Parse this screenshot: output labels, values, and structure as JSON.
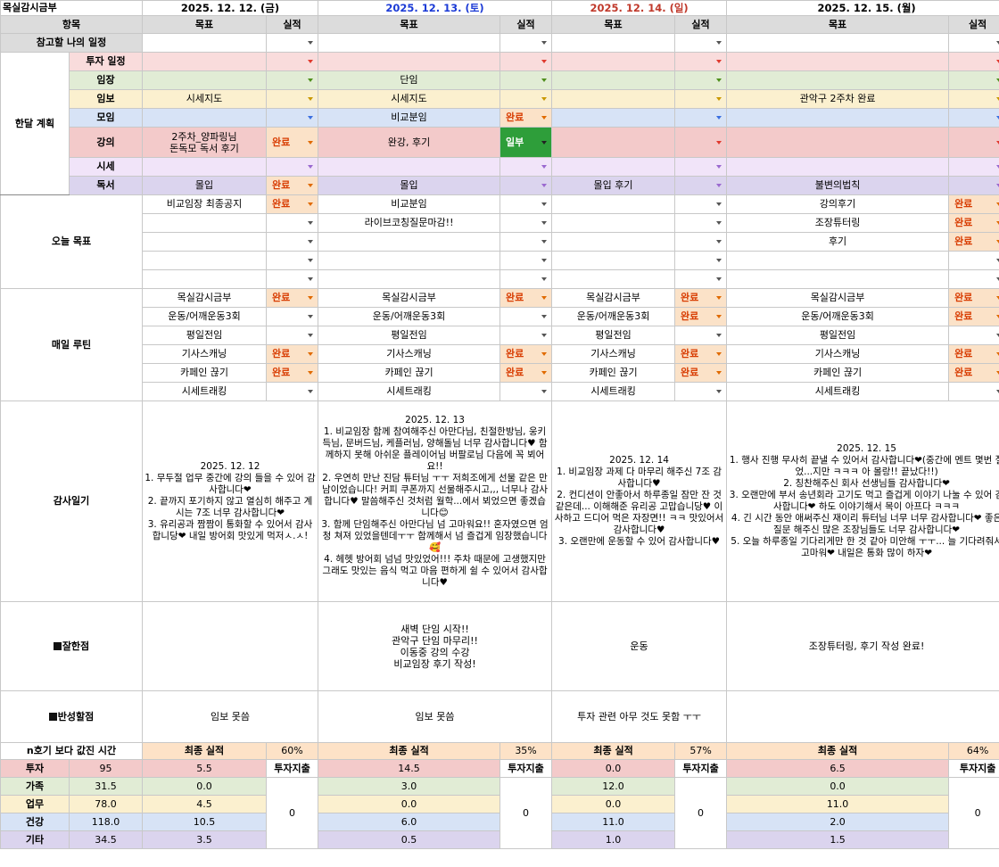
{
  "title": "목실감시금부",
  "dates": [
    "2025. 12. 12. (금)",
    "2025. 12. 13. (토)",
    "2025. 12. 14. (일)",
    "2025. 12. 15. (월)"
  ],
  "header": {
    "item": "항목",
    "goal": "목표",
    "result": "실적"
  },
  "reference_label": "참고할 나의 일정",
  "monthly_group": "한달 계획",
  "monthly_items": [
    "투자 일정",
    "임장",
    "임보",
    "모임",
    "강의",
    "시세",
    "독서"
  ],
  "monthly": {
    "d1": {
      "r2": "시세지도",
      "r4": "2주차_양파링님\n돈독모 독서 후기",
      "r4s": "완료",
      "r6": "몰입",
      "r6s": "완료"
    },
    "d2": {
      "r1": "단임",
      "r2": "시세지도",
      "r3": "비교분임",
      "r3s": "완료",
      "r4": "완강, 후기",
      "r4s": "일부",
      "r6": "몰입"
    },
    "d3": {
      "r6": "몰입 후기"
    },
    "d4": {
      "r2": "관악구 2주차 완료",
      "r6": "불변의법칙"
    }
  },
  "today_label": "오늘 목표",
  "today": {
    "d1": [
      "비교임장 최종공지",
      "",
      "",
      "",
      ""
    ],
    "d1s": [
      "완료",
      "",
      "",
      "",
      ""
    ],
    "d2": [
      "비교분임",
      "라이브코칭질문마감!!",
      "",
      "",
      ""
    ],
    "d3": [
      "",
      "",
      "",
      "",
      ""
    ],
    "d4": [
      "강의후기",
      "조장튜터링",
      "후기",
      "",
      ""
    ],
    "d4s": [
      "완료",
      "완료",
      "완료",
      "",
      ""
    ]
  },
  "routine_label": "매일 루틴",
  "routine_items": [
    "목실감시금부",
    "운동/어깨운동3회",
    "평일전임",
    "기사스캐닝",
    "카페인 끊기",
    "시세트래킹"
  ],
  "routine_status": {
    "d1": [
      "완료",
      "",
      "",
      "완료",
      "완료",
      ""
    ],
    "d2": [
      "완료",
      "",
      "",
      "완료",
      "완료",
      ""
    ],
    "d3": [
      "완료",
      "완료",
      "",
      "완료",
      "완료",
      ""
    ],
    "d4": [
      "완료",
      "완료",
      "",
      "완료",
      "완료",
      ""
    ]
  },
  "gratitude_label": "감사일기",
  "gratitude": {
    "d1": "2025. 12. 12\n1. 무두절 업무 중간에 강의 들을 수 있어 감사합니다❤\n2. 끝까지 포기하지 않고 열심히 해주고 계시는 7조 너무 감사합니다❤\n3. 유리공과 짬짬이 통화할 수 있어서 감사합니당❤ 내일 방어회 맛있게 먹저ㅅ.ㅅ!",
    "d2": "2025. 12. 13\n1. 비교임장 함께 참여해주신 아만다님, 친절한방님, 웅키득님, 문버드님, 케플러님, 양해돌님 너무 감사합니다♥ 함께하지 못해 아쉬운 플레이어님 버팔로님 다음에 꼭 뵈어요!!\n2. 우연히 만난 진담 튜터님 ㅜㅜ 저희조에게 선물 같은 만남이었습니다! 커피 쿠폰까지 선물해주시고,,, 너무나 감사합니다♥ 말씀해주신 것처럼 월학...에서 뵈었으면 좋겠습니다😊\n3. 함께 단임해주신 아만다님 넘 고마워요!! 혼자였으면 엄청 쳐져 있었을텐데ㅜㅜ 함께해서 넘 즐겁게 임장했습니다🥰\n4. 헤헷 방어회 넘넘 맛있었어!!! 주차 때문에 고생했지만 그래도 맛있는 음식 먹고 마음 편하게 쉴 수 있어서 감사합니다♥",
    "d3": "2025. 12. 14\n1. 비교임장 과제 다 마무리 해주신 7조 감사합니다♥\n2. 컨디션이 안좋아서 하루종일 잠만 잔 것 같은데... 이해해준 유리공 고맙습니당♥ 이사하고 드디어 먹은 자장면!! ㅋㅋ 맛있어서 감사합니다♥\n3. 오랜만에 운동할 수 있어 감사합니다♥",
    "d4": "2025. 12. 15\n1. 행사 진행 무사히 끝낼 수 있어서 감사합니다❤(중간에 멘트 몇번 절었...지만 ㅋㅋㅋ 아 몰랑!! 끝났다!!)\n2. 칭찬해주신 회사 선생님들 감사합니다❤\n3. 오랜만에 부서 송년회라 고기도 먹고 즐겁게 이야기 나눌 수 있어 감사합니다❤ 하도 이야기해서 목이 아프다 ㅋㅋㅋ\n4. 긴 시간 동안 애써주신 재이리 튜터님 너무 너무 감사합니다❤ 좋은 질문 해주신 많은 조장님들도 너무 감사합니다❤\n5. 오늘 하루종일 기다리게만 한 것 같아 미안해 ㅜㅜ... 늘 기다려줘서 고마워❤ 내일은 통화 많이 하자❤"
  },
  "well_label": "잘한점",
  "well": {
    "d1": "",
    "d2": "새벽 단임 시작!!\n관악구 단임 마무리!!\n이동중 강의 수강\n비교임장 후기 작성!",
    "d3": "운동",
    "d4": "조장튜터링, 후기 작성 완료!"
  },
  "reflect_label": "반성할점",
  "reflect": {
    "d1": "임보 못씀",
    "d2": "임보 못씀",
    "d3": "투자 관련 아무 것도 못함 ㅜㅜ",
    "d4": ""
  },
  "summary": {
    "label": "n호기 보다 값진 시간",
    "final_label": "최종 실적",
    "invest_out": "투자지출",
    "pct": [
      "60%",
      "35%",
      "57%",
      "64%"
    ],
    "rows": [
      {
        "name": "투자",
        "total": "95",
        "vals": [
          "5.5",
          "14.5",
          "0.0",
          "6.5"
        ]
      },
      {
        "name": "가족",
        "total": "31.5",
        "vals": [
          "0.0",
          "3.0",
          "12.0",
          "0.0"
        ]
      },
      {
        "name": "업무",
        "total": "78.0",
        "vals": [
          "4.5",
          "0.0",
          "0.0",
          "11.0"
        ]
      },
      {
        "name": "건강",
        "total": "118.0",
        "vals": [
          "10.5",
          "6.0",
          "11.0",
          "2.0"
        ]
      },
      {
        "name": "기타",
        "total": "34.5",
        "vals": [
          "3.5",
          "0.5",
          "1.0",
          "1.5"
        ]
      }
    ],
    "invest_amounts": [
      "0",
      "0",
      "0",
      "0"
    ]
  },
  "colors": {
    "invest": "#f9dcdc",
    "site": "#e1ecd5",
    "report": "#fbf0cf",
    "meeting": "#d7e3f6",
    "lecture": "#f3caca",
    "price": "#f1e4f9",
    "reading": "#dbd4ee",
    "done": "#fbe2c8",
    "partial": "#2e9e3a"
  }
}
